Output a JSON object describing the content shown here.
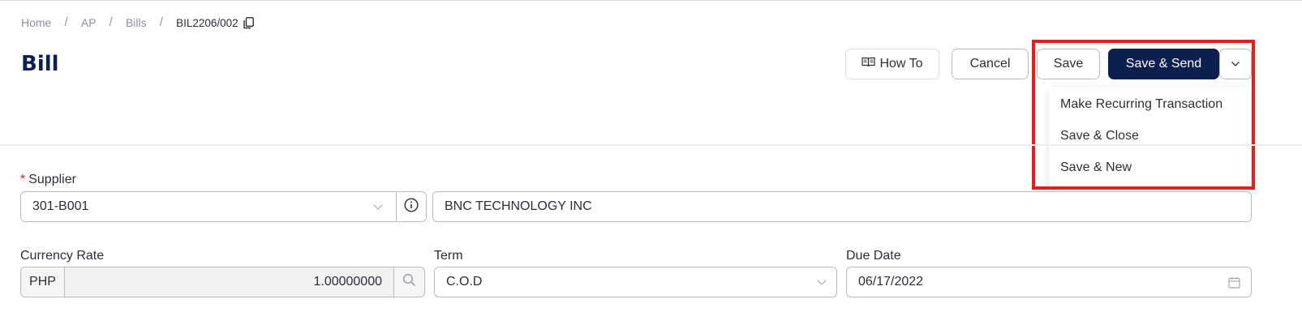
{
  "breadcrumb": {
    "home": "Home",
    "ap": "AP",
    "bills": "Bills",
    "current": "BIL2206/002",
    "sep": "/"
  },
  "page": {
    "title": "Bill"
  },
  "toolbar": {
    "howto_label": "How To",
    "cancel_label": "Cancel",
    "save_label": "Save",
    "save_send_label": "Save & Send"
  },
  "dropdown": {
    "items": [
      {
        "label": "Make Recurring Transaction"
      },
      {
        "label": "Save & Close"
      },
      {
        "label": "Save & New"
      }
    ]
  },
  "form": {
    "supplier": {
      "label": "Supplier",
      "required_mark": "*",
      "code": "301-B001",
      "name": "BNC TECHNOLOGY INC"
    },
    "currency_rate": {
      "label": "Currency Rate",
      "currency": "PHP",
      "rate": "1.00000000"
    },
    "term": {
      "label": "Term",
      "value": "C.O.D"
    },
    "due_date": {
      "label": "Due Date",
      "value": "06/17/2022"
    }
  },
  "colors": {
    "primary": "#0c1f4d",
    "title": "#0c2152",
    "highlight": "#e02020",
    "required": "#e02020"
  }
}
